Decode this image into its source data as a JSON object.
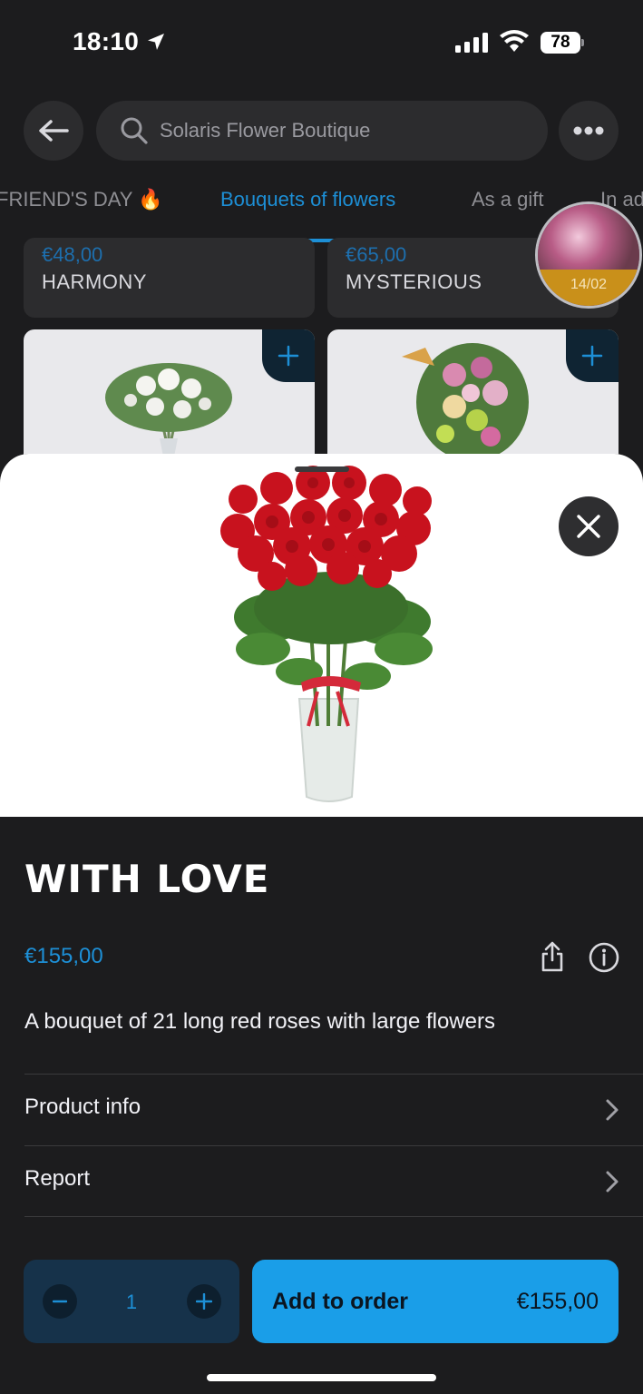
{
  "status_bar": {
    "time": "18:10",
    "battery": "78"
  },
  "header": {
    "search_placeholder": "Solaris Flower Boutique",
    "tabs": [
      {
        "label": "FRIEND'S DAY 🔥",
        "active": false
      },
      {
        "label": "Bouquets of flowers",
        "active": true
      },
      {
        "label": "As a gift",
        "active": false
      },
      {
        "label": "In ad",
        "active": false
      }
    ]
  },
  "grid": {
    "cards": [
      {
        "price": "€48,00",
        "name": "HARMONY"
      },
      {
        "price": "€65,00",
        "name": "MYSTERIOUS"
      }
    ]
  },
  "story": {
    "date": "14/02"
  },
  "product": {
    "title": "WITH LOVE",
    "price": "€155,00",
    "description": "A bouquet of 21 long red roses with large flowers",
    "rows": [
      {
        "label": "Product info"
      },
      {
        "label": "Report"
      }
    ],
    "quantity": "1",
    "add_label": "Add to order",
    "add_price": "€155,00"
  },
  "colors": {
    "accent": "#1d8fd6",
    "button": "#1a9ee8",
    "background": "#1c1c1e"
  }
}
